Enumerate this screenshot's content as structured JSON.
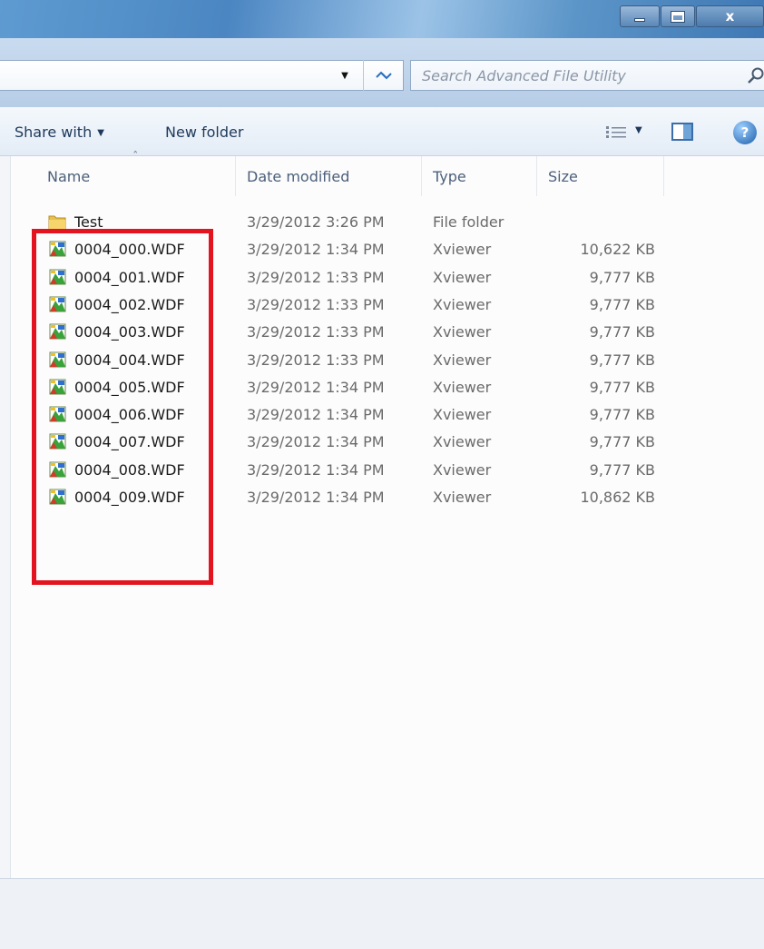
{
  "window": {
    "minimize_icon": "minimize-icon",
    "maximize_icon": "maximize-icon",
    "close_label": "x"
  },
  "address": {
    "dropdown_icon": "chevron-down-icon",
    "refresh_icon": "refresh-icon",
    "search_placeholder": "Search Advanced File Utility",
    "search_icon": "search-icon"
  },
  "toolbar": {
    "share_label": "Share with",
    "new_folder_label": "New folder",
    "views_icon": "views-icon",
    "preview_icon": "preview-pane-icon",
    "help_icon": "help-icon",
    "help_glyph": "?"
  },
  "columns": {
    "name": "Name",
    "date": "Date modified",
    "type": "Type",
    "size": "Size"
  },
  "files": [
    {
      "name": "Test",
      "date": "3/29/2012 3:26 PM",
      "type": "File folder",
      "size": "",
      "icon": "folder-icon"
    },
    {
      "name": "0004_000.WDF",
      "date": "3/29/2012 1:34 PM",
      "type": "Xviewer",
      "size": "10,622 KB",
      "icon": "xviewer-file-icon"
    },
    {
      "name": "0004_001.WDF",
      "date": "3/29/2012 1:33 PM",
      "type": "Xviewer",
      "size": "9,777 KB",
      "icon": "xviewer-file-icon"
    },
    {
      "name": "0004_002.WDF",
      "date": "3/29/2012 1:33 PM",
      "type": "Xviewer",
      "size": "9,777 KB",
      "icon": "xviewer-file-icon"
    },
    {
      "name": "0004_003.WDF",
      "date": "3/29/2012 1:33 PM",
      "type": "Xviewer",
      "size": "9,777 KB",
      "icon": "xviewer-file-icon"
    },
    {
      "name": "0004_004.WDF",
      "date": "3/29/2012 1:33 PM",
      "type": "Xviewer",
      "size": "9,777 KB",
      "icon": "xviewer-file-icon"
    },
    {
      "name": "0004_005.WDF",
      "date": "3/29/2012 1:34 PM",
      "type": "Xviewer",
      "size": "9,777 KB",
      "icon": "xviewer-file-icon"
    },
    {
      "name": "0004_006.WDF",
      "date": "3/29/2012 1:34 PM",
      "type": "Xviewer",
      "size": "9,777 KB",
      "icon": "xviewer-file-icon"
    },
    {
      "name": "0004_007.WDF",
      "date": "3/29/2012 1:34 PM",
      "type": "Xviewer",
      "size": "9,777 KB",
      "icon": "xviewer-file-icon"
    },
    {
      "name": "0004_008.WDF",
      "date": "3/29/2012 1:34 PM",
      "type": "Xviewer",
      "size": "9,777 KB",
      "icon": "xviewer-file-icon"
    },
    {
      "name": "0004_009.WDF",
      "date": "3/29/2012 1:34 PM",
      "type": "Xviewer",
      "size": "10,862 KB",
      "icon": "xviewer-file-icon"
    }
  ],
  "colors": {
    "highlight": "#e3141f",
    "titlebar": "#4b86c2"
  }
}
